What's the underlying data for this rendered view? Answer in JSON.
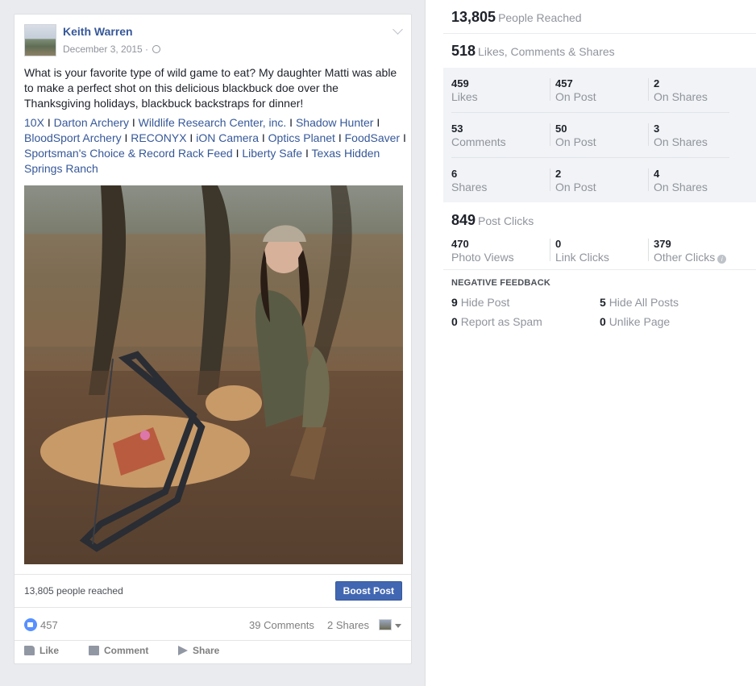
{
  "post": {
    "author": "Keith Warren",
    "date": "December 3, 2015 ·",
    "text": "What is your favorite type of wild game to eat? My daughter Matti was able to make a perfect shot on this delicious blackbuck doe over the Thanksgiving holidays, blackbuck backstraps for dinner!",
    "tags": [
      "10X",
      "Darton Archery",
      "Wildlife Research Center, inc.",
      "Shadow Hunter",
      "BloodSport Archery",
      "RECONYX",
      "iON Camera",
      "Optics Planet",
      "FoodSaver",
      "Sportsman's Choice & Record Rack Feed",
      "Liberty Safe",
      "Texas Hidden Springs Ranch"
    ],
    "tag_separator": "I",
    "people_reached": "13,805 people reached",
    "boost_label": "Boost Post",
    "like_count": "457",
    "comments_count": "39 Comments",
    "shares_count": "2 Shares",
    "actions": {
      "like": "Like",
      "comment": "Comment",
      "share": "Share"
    },
    "colors": {
      "link": "#365899",
      "boost": "#4267b2"
    }
  },
  "insights": {
    "reached": {
      "value": "13,805",
      "label": "People Reached"
    },
    "engagement": {
      "value": "518",
      "label": "Likes, Comments & Shares"
    },
    "grid": [
      [
        {
          "num": "459",
          "sub": "Likes"
        },
        {
          "num": "457",
          "sub": "On Post"
        },
        {
          "num": "2",
          "sub": "On Shares"
        }
      ],
      [
        {
          "num": "53",
          "sub": "Comments"
        },
        {
          "num": "50",
          "sub": "On Post"
        },
        {
          "num": "3",
          "sub": "On Shares"
        }
      ],
      [
        {
          "num": "6",
          "sub": "Shares"
        },
        {
          "num": "2",
          "sub": "On Post"
        },
        {
          "num": "4",
          "sub": "On Shares"
        }
      ]
    ],
    "clicks": {
      "value": "849",
      "label": "Post Clicks"
    },
    "click_breakdown": [
      {
        "num": "470",
        "sub": "Photo Views"
      },
      {
        "num": "0",
        "sub": "Link Clicks"
      },
      {
        "num": "379",
        "sub": "Other Clicks"
      }
    ],
    "negative_title": "NEGATIVE FEEDBACK",
    "negative": [
      {
        "num": "9",
        "sub": "Hide Post"
      },
      {
        "num": "5",
        "sub": "Hide All Posts"
      },
      {
        "num": "0",
        "sub": "Report as Spam"
      },
      {
        "num": "0",
        "sub": "Unlike Page"
      }
    ]
  }
}
